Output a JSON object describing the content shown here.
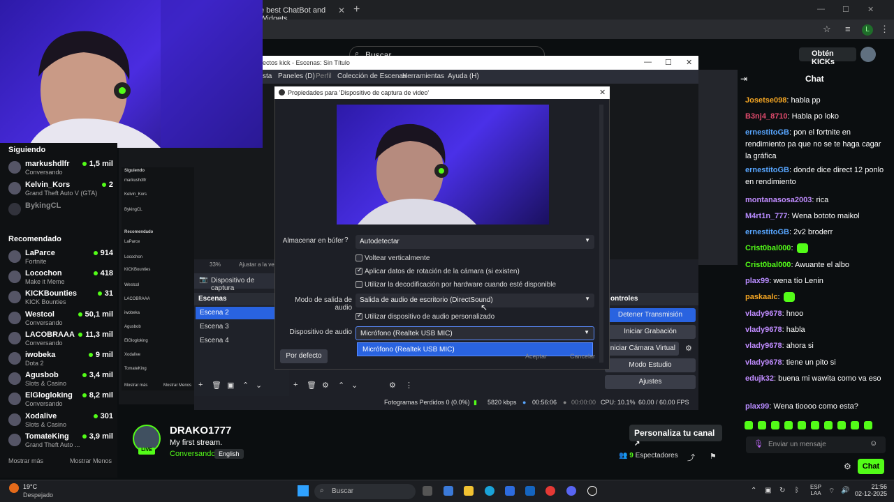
{
  "browser": {
    "tab_title": "e best ChatBot and Widgets",
    "search_placeholder": "Buscar",
    "obtain_kicks": "Obtén KICKs",
    "profile_letter": "L"
  },
  "sidebar": {
    "following_title": "Siguiendo",
    "following": [
      {
        "name": "markushdlfr",
        "category": "Conversando",
        "viewers": "1,5 mil"
      },
      {
        "name": "Kelvin_Kors",
        "category": "Grand Theft Auto V (GTA)",
        "viewers": "2"
      },
      {
        "name": "BykingCL",
        "category": "",
        "viewers": ""
      }
    ],
    "recommended_title": "Recomendado",
    "recommended": [
      {
        "name": "LaParce",
        "category": "Fortnite",
        "viewers": "914"
      },
      {
        "name": "Locochon",
        "category": "Make it Meme",
        "viewers": "418"
      },
      {
        "name": "KICKBounties",
        "category": "KICK Bounties",
        "viewers": "31"
      },
      {
        "name": "Westcol",
        "category": "Conversando",
        "viewers": "50,1 mil"
      },
      {
        "name": "LACOBRAAA",
        "category": "Conversando",
        "viewers": "11,3 mil"
      },
      {
        "name": "iwobeka",
        "category": "Dota 2",
        "viewers": "9 mil"
      },
      {
        "name": "Agusbob",
        "category": "Slots & Casino",
        "viewers": "3,4 mil"
      },
      {
        "name": "ElGlogloking",
        "category": "Conversando",
        "viewers": "8,2 mil"
      },
      {
        "name": "Xodalive",
        "category": "Slots & Casino",
        "viewers": "301"
      },
      {
        "name": "TomateKing",
        "category": "Grand Theft Auto ...",
        "viewers": "3,9 mil"
      }
    ],
    "show_more": "Mostrar más",
    "show_less": "Mostrar Menos"
  },
  "obs": {
    "title": "ectos kick - Escenas: Sin Título",
    "menu": [
      "sta",
      "Paneles (D)",
      "Perfil",
      "Colección de Escenas",
      "Herramientas",
      "Ayuda (H)"
    ],
    "zoom": "33%",
    "zoom_label": "Ajustar a la ve",
    "source_name": "Dispositivo de captura",
    "scenes_title": "Escenas",
    "scenes": [
      "Escena 2",
      "Escena 3",
      "Escena 4"
    ],
    "controls_title": "ontroles",
    "controls": [
      "Detener Transmisión",
      "Iniciar Grabación",
      "Iniciar Cámara Virtual",
      "Modo Estudio",
      "Ajustes"
    ],
    "status": {
      "dropped": "Fotogramas Perdidos 0 (0.0%)",
      "bitrate": "5820 kbps",
      "live_time": "00:56:06",
      "rec_time": "00:00:00",
      "cpu": "CPU: 10.1%",
      "fps": "60.00 / 60.00 FPS"
    }
  },
  "dialog": {
    "title": "Propiedades para 'Dispositivo de captura de video'",
    "buffer_label": "Almacenar en búfer",
    "buffer_value": "Autodetectar",
    "flip_label": "Voltear verticalmente",
    "rotation_label": "Aplicar datos de rotación de la cámara (si existen)",
    "hwdecode_label": "Utilizar la decodificación por hardware cuando esté disponible",
    "audio_mode_label": "Modo de salida de audio",
    "audio_mode_value": "Salida de audio de escritorio (DirectSound)",
    "custom_audio_label": "Utilizar dispositivo de audio personalizado",
    "audio_device_label": "Dispositivo de audio",
    "audio_device_value": "Micrófono (Realtek USB MIC)",
    "dropdown_option": "Micrófono (Realtek USB MIC)",
    "default_button": "Por defecto",
    "accept_button": "Aceptar",
    "cancel_button": "Cancelar",
    "flip_checked": false,
    "rotation_checked": true,
    "hwdecode_checked": false,
    "custom_audio_checked": true
  },
  "stream": {
    "streamer": "DRAKO1777",
    "title": "My first stream.",
    "category": "Conversando",
    "language": "English",
    "live_badge": "LIVE",
    "customize": "Personaliza tu canal",
    "viewers_count": "9",
    "viewers_label": "Espectadores"
  },
  "chat": {
    "title": "Chat",
    "messages": [
      {
        "user": "Josetse098",
        "color": "#f5a623",
        "text": "habla pp"
      },
      {
        "user": "B3nj4_8710",
        "color": "#e04a6c",
        "text": "Habla po loko"
      },
      {
        "user": "ernestitoGB",
        "color": "#58a6ff",
        "text": "pon el fortnite en rendimiento pa que no se te haga cagar la gráfica"
      },
      {
        "user": "ernestitoGB",
        "color": "#58a6ff",
        "text": "donde dice direct 12 ponlo en rendimiento"
      },
      {
        "user": "montanasosa2003",
        "color": "#c08cff",
        "text": "rica"
      },
      {
        "user": "M4rt1n_777",
        "color": "#b88cff",
        "text": "Wena bototo maikol"
      },
      {
        "user": "ernestitoGB",
        "color": "#58a6ff",
        "text": "2v2 broderr"
      },
      {
        "user": "Crist0bal000",
        "color": "#53fc18",
        "text": ""
      },
      {
        "user": "Crist0bal000",
        "color": "#53fc18",
        "text": "Awuante el albo"
      },
      {
        "user": "plax99",
        "color": "#b88cff",
        "text": "wena tío Lenin"
      },
      {
        "user": "paskaalc",
        "color": "#f5a623",
        "text": ""
      },
      {
        "user": "vlady9678",
        "color": "#c08cff",
        "text": "hnoo"
      },
      {
        "user": "vlady9678",
        "color": "#c08cff",
        "text": "habla"
      },
      {
        "user": "vlady9678",
        "color": "#c08cff",
        "text": "ahora si"
      },
      {
        "user": "vlady9678",
        "color": "#c08cff",
        "text": "tiene un pito si"
      },
      {
        "user": "edujk32",
        "color": "#c08cff",
        "text": "buena mi wawita como va eso"
      },
      {
        "user": "plax99",
        "color": "#b88cff",
        "text": "Wena tioooo como esta?"
      }
    ],
    "input_placeholder": "Enviar un mensaje",
    "send": "Chat"
  },
  "taskbar": {
    "temp": "19°C",
    "weather": "Despejado",
    "search": "Buscar",
    "lang_top": "ESP",
    "lang_bottom": "LAA",
    "time": "21:56",
    "date": "02-12-2025"
  },
  "colors": {
    "kick_green": "#53fc18",
    "obs_blue": "#2963e0"
  }
}
